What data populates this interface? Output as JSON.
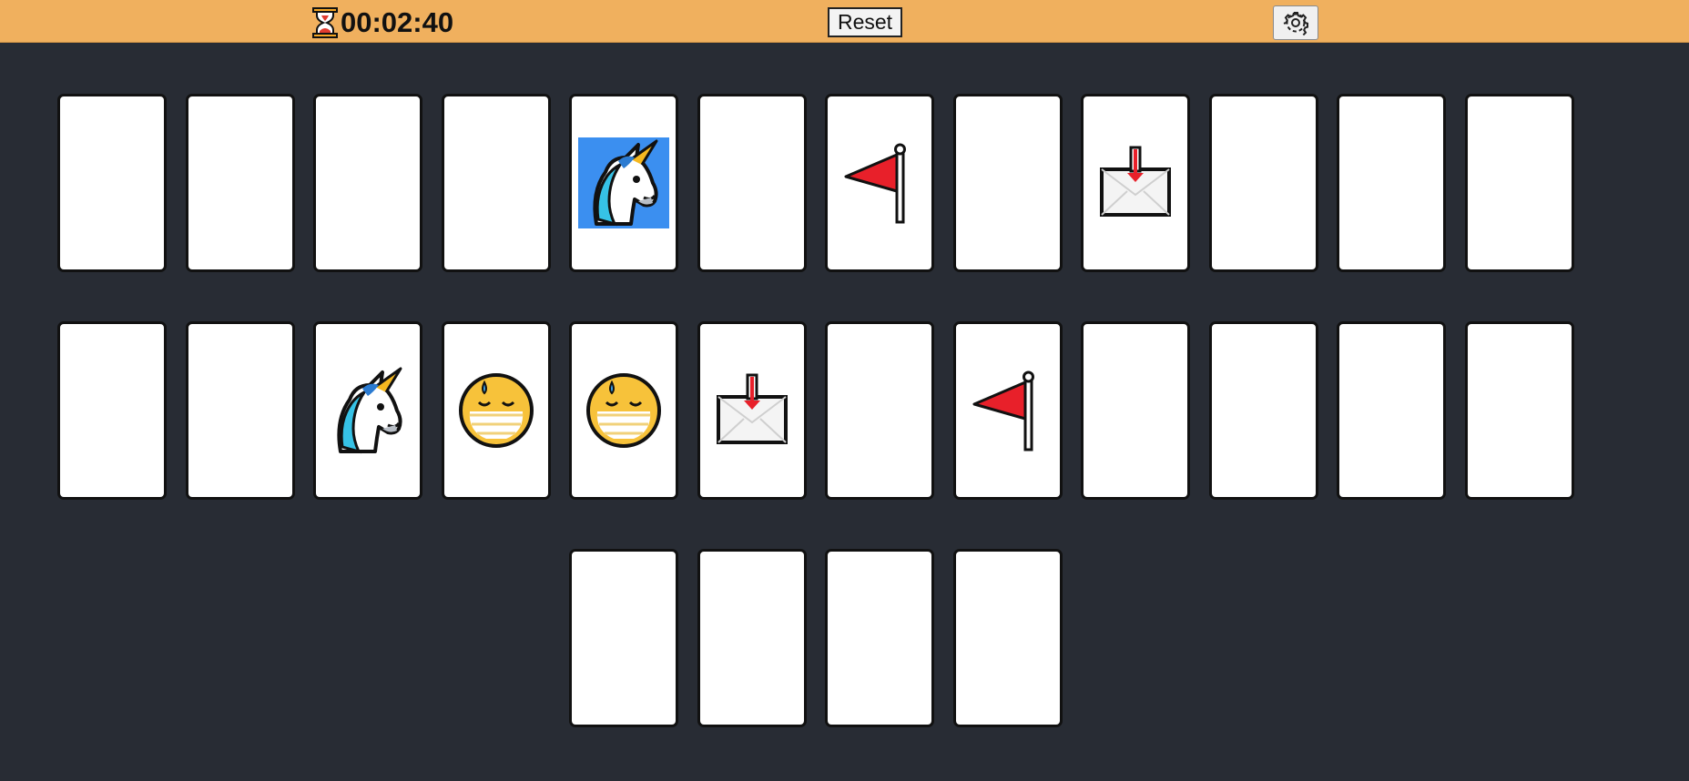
{
  "header": {
    "timer": "00:02:40",
    "reset_label": "Reset"
  },
  "icons": {
    "timer": "hourglass-icon",
    "settings": "gear-icon"
  },
  "colors": {
    "header_bg": "#f0b05e",
    "board_bg": "#282c34",
    "card_face": "#ffffff",
    "unicorn_highlight": "#3b8ff0"
  },
  "board": {
    "rows": [
      [
        {
          "state": "hidden"
        },
        {
          "state": "hidden"
        },
        {
          "state": "hidden"
        },
        {
          "state": "hidden"
        },
        {
          "state": "revealed",
          "icon": "unicorn",
          "highlighted": true
        },
        {
          "state": "hidden"
        },
        {
          "state": "revealed",
          "icon": "red-flag"
        },
        {
          "state": "hidden"
        },
        {
          "state": "revealed",
          "icon": "inbox-envelope"
        },
        {
          "state": "hidden"
        },
        {
          "state": "hidden"
        },
        {
          "state": "hidden"
        }
      ],
      [
        {
          "state": "hidden"
        },
        {
          "state": "hidden"
        },
        {
          "state": "revealed",
          "icon": "unicorn"
        },
        {
          "state": "revealed",
          "icon": "masked-face"
        },
        {
          "state": "revealed",
          "icon": "masked-face"
        },
        {
          "state": "revealed",
          "icon": "inbox-envelope"
        },
        {
          "state": "hidden"
        },
        {
          "state": "revealed",
          "icon": "red-flag"
        },
        {
          "state": "hidden"
        },
        {
          "state": "hidden"
        },
        {
          "state": "hidden"
        },
        {
          "state": "hidden"
        }
      ],
      [
        {
          "state": "hidden"
        },
        {
          "state": "hidden"
        },
        {
          "state": "hidden"
        },
        {
          "state": "hidden"
        }
      ]
    ]
  }
}
